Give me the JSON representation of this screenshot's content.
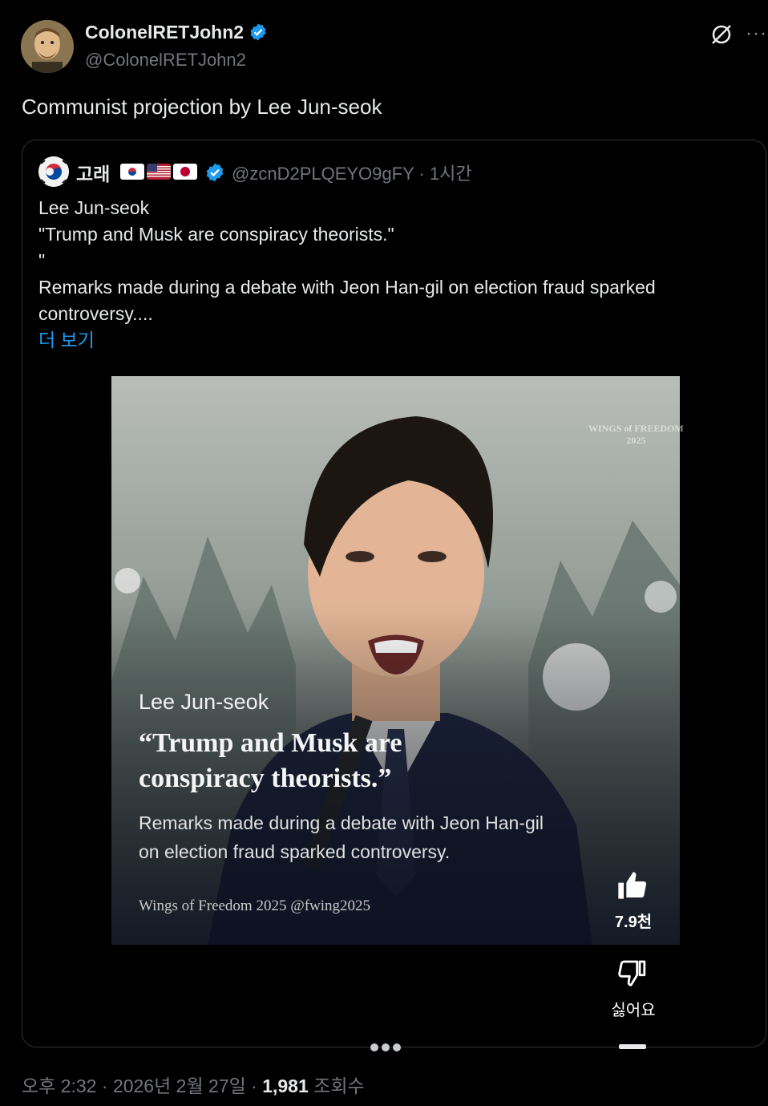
{
  "author": {
    "display_name": "ColonelRETJohn2",
    "handle": "@ColonelRETJohn2",
    "verified": true,
    "avatar_icon": "cartoon-man-avatar"
  },
  "header_actions": {
    "grok_icon": "grok-slash-circle-icon",
    "more_label": "···"
  },
  "tweet": {
    "text": "Communist projection by Lee Jun-seok"
  },
  "quoted": {
    "display_name": "고래",
    "flags": [
      "kr",
      "us",
      "jp"
    ],
    "verified": true,
    "handle": "@zcnD2PLQEYO9gFY",
    "separator": "·",
    "time": "1시간",
    "body_lines": [
      "Lee Jun-seok",
      "\"Trump and Musk are conspiracy theorists.\"",
      "\"",
      "Remarks made during a debate with Jeon Han-gil on election fraud sparked",
      "controversy...."
    ],
    "show_more": "더 보기",
    "media": {
      "name": "Lee Jun-seok",
      "quote_line1": "“Trump and Musk are",
      "quote_line2": "conspiracy theorists.”",
      "subtitle_line1": "Remarks made during a debate with Jeon Han-gil",
      "subtitle_line2": "on election fraud sparked controversy.",
      "credit": "Wings of Freedom 2025 @fwing2025",
      "watermark_line1": "WINGS of FREEDOM",
      "watermark_line2": "2025",
      "like_count": "7.9천",
      "dislike_label": "싫어요"
    }
  },
  "footer": {
    "time": "오후 2:32",
    "sep1": "·",
    "date": "2026년 2월 27일",
    "sep2": "·",
    "views": "1,981",
    "views_label": "조회수"
  },
  "colors": {
    "background": "#000000",
    "text": "#e7e9ea",
    "muted": "#71767b",
    "link": "#1d9bf0",
    "verified": "#1d9bf0"
  }
}
